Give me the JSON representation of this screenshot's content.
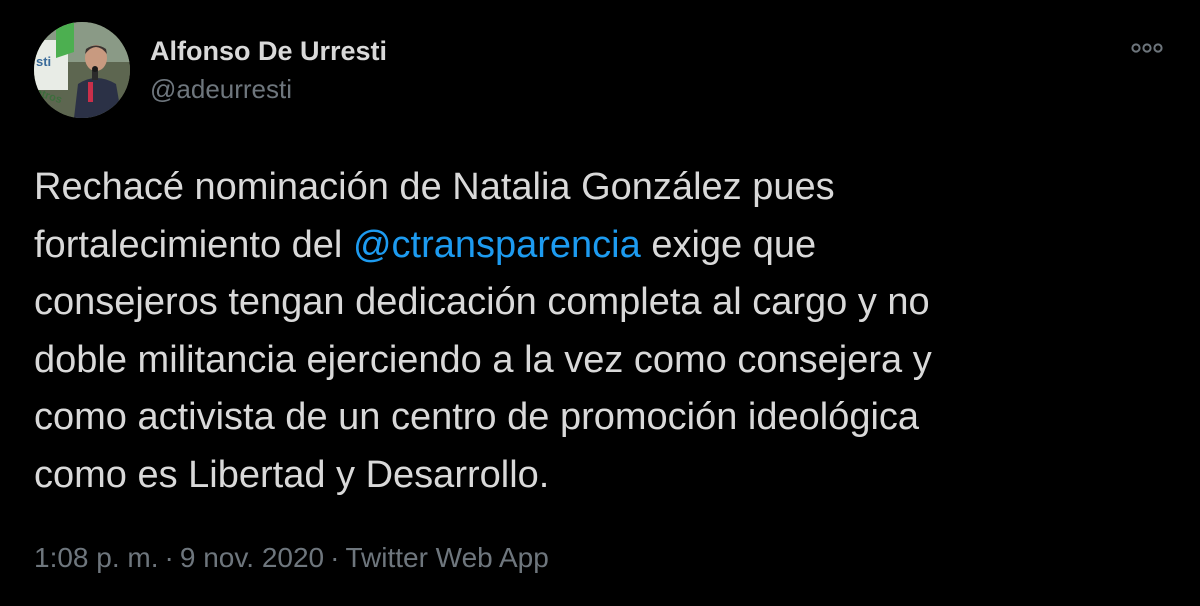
{
  "author": {
    "display_name": "Alfonso De Urresti",
    "handle": "@adeurresti"
  },
  "tweet": {
    "line1": "Rechacé nominación de Natalia González pues",
    "line2_before": "fortalecimiento del ",
    "mention": "@ctransparencia",
    "line2_after": " exige que",
    "line3": "consejeros tengan dedicación completa al cargo y no",
    "line4": "doble militancia ejerciendo a la vez como consejera y",
    "line5": "como activista de un centro de promoción ideológica",
    "line6": "como es Libertad y Desarrollo."
  },
  "meta": {
    "time": "1:08 p. m.",
    "separator": "·",
    "date": "9 nov. 2020",
    "source": "Twitter Web App"
  },
  "icons": {
    "more": "more-options-icon",
    "avatar": "profile-photo"
  },
  "colors": {
    "background": "#000000",
    "text": "#d9d9d9",
    "secondary": "#6e767d",
    "link": "#1d9bf0"
  }
}
